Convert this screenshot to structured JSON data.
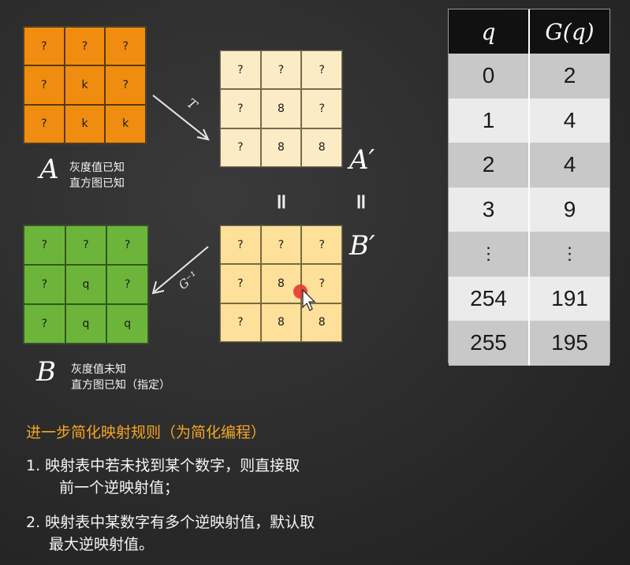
{
  "grids": {
    "A": [
      "?",
      "?",
      "?",
      "?",
      "k",
      "?",
      "?",
      "k",
      "k"
    ],
    "A_prime": [
      "?",
      "?",
      "?",
      "?",
      "8",
      "?",
      "?",
      "8",
      "8"
    ],
    "B": [
      "?",
      "?",
      "?",
      "?",
      "q",
      "?",
      "?",
      "q",
      "q"
    ],
    "B_prime": [
      "?",
      "?",
      "?",
      "?",
      "8",
      "?",
      "?",
      "8",
      "8"
    ]
  },
  "labels": {
    "A": "A",
    "A_prime": "A′",
    "B": "B",
    "B_prime": "B′",
    "T": "T",
    "G_inv": "G⁻¹",
    "eq1": "॥",
    "eq2": "॥"
  },
  "notes": {
    "a_line1": "灰度值已知",
    "a_line2": "直方图已知",
    "b_line1": "灰度值未知",
    "b_line2": "直方图已知（指定）"
  },
  "table": {
    "headers": [
      "q",
      "G(q)"
    ],
    "rows": [
      [
        "0",
        "2"
      ],
      [
        "1",
        "4"
      ],
      [
        "2",
        "4"
      ],
      [
        "3",
        "9"
      ],
      [
        "⋮",
        "⋮"
      ],
      [
        "254",
        "191"
      ],
      [
        "255",
        "195"
      ]
    ]
  },
  "rules": {
    "title": "进一步简化映射规则（为简化编程）",
    "r1_line1": "1.   映射表中若未找到某个数字，则直接取",
    "r1_line2": "前一个逆映射值；",
    "r2_line1": "2. 映射表中某数字有多个逆映射值，默认取",
    "r2_line2": "最大逆映射值。"
  },
  "colors": {
    "grid_a": "#f08c10",
    "grid_a_prime": "#fcecc5",
    "grid_b": "#6cb53a",
    "grid_b_prime": "#fde09a",
    "rule_title": "#f5a623",
    "cursor_dot": "#e53935"
  }
}
